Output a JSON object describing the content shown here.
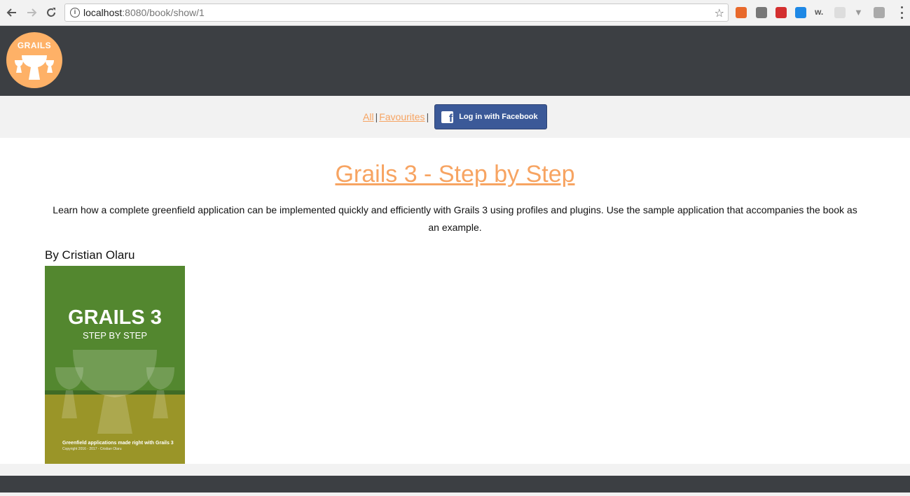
{
  "browser": {
    "url_host": "localhost",
    "url_rest": ":8080/book/show/1"
  },
  "header": {
    "logo_text": "GRAILS"
  },
  "nav": {
    "all_label": "All ",
    "sep1": "|",
    "favourites_label": "Favourites ",
    "sep2": "|",
    "facebook_label": "Log in with Facebook"
  },
  "book": {
    "title": "Grails 3 - Step by Step",
    "description": "Learn how a complete greenfield application can be implemented quickly and efficiently with Grails 3 using profiles and plugins. Use the sample application that accompanies the book as an example.",
    "author": "By Cristian Olaru",
    "cover": {
      "title": "GRAILS 3",
      "subtitle": "STEP BY STEP",
      "tagline": "Greenfield applications made right with Grails 3",
      "copyright": "Copyright 2016 - 2017  -  Cristian Olaru"
    }
  },
  "colors": {
    "accent": "#f7a462",
    "header_bg": "#3c3f43",
    "facebook": "#3b5998"
  },
  "icons": [
    "back-icon",
    "forward-icon",
    "reload-icon",
    "info-icon",
    "star-icon",
    "facebook-icon",
    "menu-dots-icon"
  ]
}
